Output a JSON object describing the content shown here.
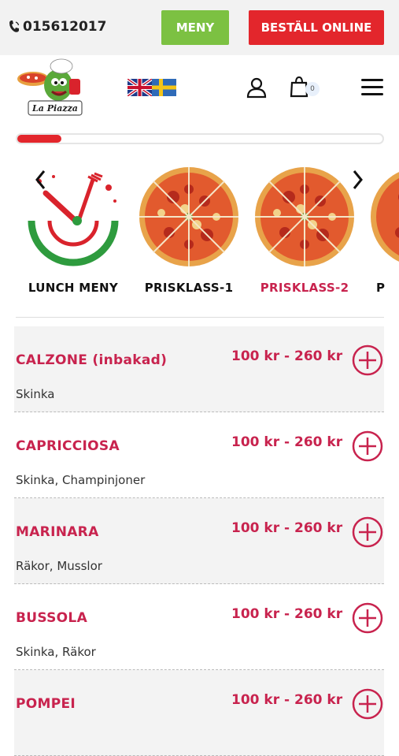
{
  "topbar": {
    "phone": "015612017",
    "menu_button": "MENY",
    "order_button": "BESTÄLL ONLINE"
  },
  "header": {
    "logo_text": "La Piazza",
    "cart_count": "0"
  },
  "progress": {
    "fraction": 0.12
  },
  "categories": [
    {
      "label": "LUNCH MENY",
      "icon": "plate-fork-knife-icon"
    },
    {
      "label": "PRISKLASS-1",
      "icon": "pizza-image"
    },
    {
      "label": "PRISKLASS-2",
      "icon": "pizza-image",
      "active": true
    },
    {
      "label": "P",
      "icon": "pizza-image"
    }
  ],
  "items": [
    {
      "name": "CALZONE (inbakad)",
      "desc": "Skinka",
      "price": "100 kr  - 260 kr"
    },
    {
      "name": "CAPRICCIOSA",
      "desc": "Skinka, Champinjoner",
      "price": "100 kr  - 260 kr"
    },
    {
      "name": "MARINARA",
      "desc": "Räkor, Musslor",
      "price": "100 kr  - 260 kr"
    },
    {
      "name": "BUSSOLA",
      "desc": "Skinka, Räkor",
      "price": "100 kr  - 260 kr"
    },
    {
      "name": "POMPEI",
      "desc": "",
      "price": "100 kr  - 260 kr"
    }
  ],
  "colors": {
    "accent": "#e3262c",
    "name_red": "#c8234e",
    "green": "#7cc142"
  }
}
